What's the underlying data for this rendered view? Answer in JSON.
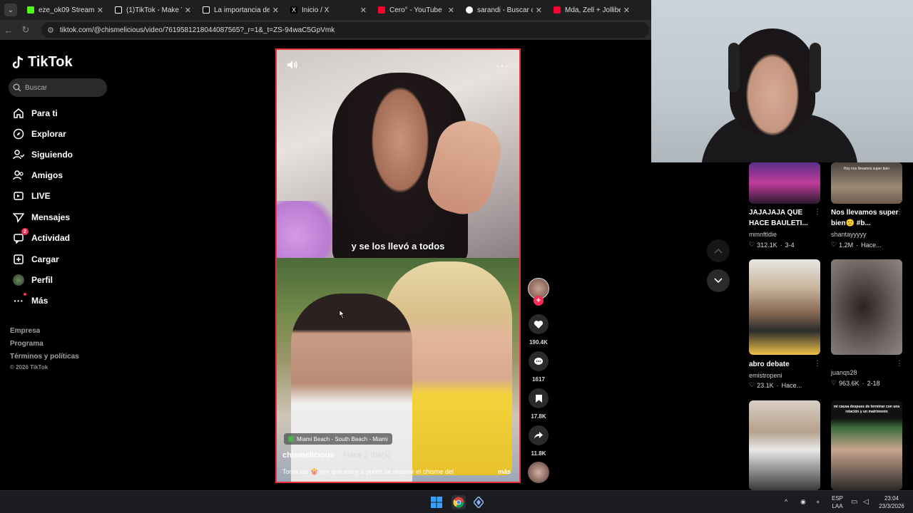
{
  "browser": {
    "tabs": [
      {
        "label": "eze_ok09 Stream - W",
        "favicon_color": "#53fc18"
      },
      {
        "label": "(1)TikTok - Make You",
        "favicon_color": "#ffffff"
      },
      {
        "label": "La importancia de la",
        "favicon_color": "#ffffff"
      },
      {
        "label": "Inicio / X",
        "favicon_color": "#ffffff"
      },
      {
        "label": "Cero° - YouTube",
        "favicon_color": "#ff0033"
      },
      {
        "label": "sarandi - Buscar con",
        "favicon_color": "#ffffff"
      },
      {
        "label": "Mda, Zell + Jollibee (",
        "favicon_color": "#ff0033"
      }
    ],
    "url": "tiktok.com/@chismelicious/video/7619581218044087565?_r=1&_t=ZS-94waC5GpVmk"
  },
  "tiktok": {
    "logo": "TikTok",
    "search_placeholder": "Buscar",
    "nav": [
      {
        "label": "Para ti",
        "icon": "home-icon"
      },
      {
        "label": "Explorar",
        "icon": "compass-icon"
      },
      {
        "label": "Siguiendo",
        "icon": "following-icon"
      },
      {
        "label": "Amigos",
        "icon": "friends-icon"
      },
      {
        "label": "LIVE",
        "icon": "live-icon"
      },
      {
        "label": "Mensajes",
        "icon": "messages-icon"
      },
      {
        "label": "Actividad",
        "icon": "activity-icon",
        "badge": "2"
      },
      {
        "label": "Cargar",
        "icon": "upload-icon"
      },
      {
        "label": "Perfil",
        "icon": "profile-avatar"
      },
      {
        "label": "Más",
        "icon": "more-icon"
      }
    ],
    "footer": [
      "Empresa",
      "Programa",
      "Términos y políticas"
    ],
    "copyright": "© 2026 TikTok"
  },
  "video": {
    "caption": "y se los llevó a todos",
    "location": "Miami Beach - South Beach - Miami",
    "author": "chismelicious",
    "time": "· Hace 2 día(s)",
    "description": "Toma tus 🍿 por que estoy a punto de resumir el chisme del",
    "more_label": "más",
    "likes": "190.4K",
    "comments": "1617",
    "saves": "17.8K",
    "shares": "11.8K"
  },
  "grid": [
    {
      "title": "JAJAJAJA QUE HACE BAULETI...",
      "user": "mmnftldie",
      "likes": "312.1K",
      "date": "3-4"
    },
    {
      "title": "Nos llevamos super bien🙂 #b...",
      "user": "shantayyyyy",
      "likes": "1.2M",
      "date": "Hace..."
    },
    {
      "title": "abro debate",
      "user": "emistropeni",
      "likes": "23.1K",
      "date": "Hace..."
    },
    {
      "title": "",
      "user": "juanqs28",
      "likes": "963.6K",
      "date": "2-18"
    }
  ],
  "thumb_overlays": {
    "top_right": "Hoy nos llevamos super bien",
    "bottom_right": "mi causa despues de terminar con una relación y un matrimonio"
  },
  "taskbar": {
    "lang": "ESP",
    "layout": "LAA",
    "time": "23:04",
    "date": "23/3/2026"
  }
}
